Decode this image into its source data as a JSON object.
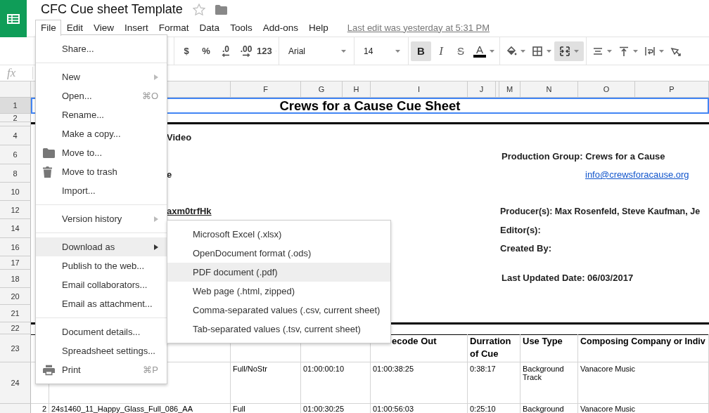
{
  "app": {
    "title": "CFC Cue sheet Template",
    "starred": false,
    "last_edit": "Last edit was yesterday at 5:31 PM"
  },
  "menus": [
    {
      "label": "File",
      "selected": true
    },
    {
      "label": "Edit",
      "selected": false
    },
    {
      "label": "View",
      "selected": false
    },
    {
      "label": "Insert",
      "selected": false
    },
    {
      "label": "Format",
      "selected": false
    },
    {
      "label": "Data",
      "selected": false
    },
    {
      "label": "Tools",
      "selected": false
    },
    {
      "label": "Add-ons",
      "selected": false
    },
    {
      "label": "Help",
      "selected": false
    }
  ],
  "toolbar": {
    "groups": [
      [
        {
          "kind": "text",
          "label": "$",
          "selected": false,
          "dropdown": false
        },
        {
          "kind": "text",
          "label": "%",
          "selected": false,
          "dropdown": false
        },
        {
          "kind": "decrease-decimals",
          "label": ".0",
          "selected": false,
          "dropdown": false
        },
        {
          "kind": "increase-decimals",
          "label": ".00",
          "selected": false,
          "dropdown": false
        },
        {
          "kind": "text",
          "label": "123",
          "selected": false,
          "dropdown": true
        }
      ],
      [
        {
          "kind": "font",
          "label": "Arial",
          "selected": false,
          "dropdown": true
        }
      ],
      [
        {
          "kind": "size",
          "label": "14",
          "selected": false,
          "dropdown": true
        }
      ],
      [
        {
          "kind": "bold",
          "label": "B",
          "selected": true,
          "dropdown": false
        },
        {
          "kind": "italic",
          "label": "I",
          "selected": false,
          "dropdown": false
        },
        {
          "kind": "strike",
          "label": "S",
          "selected": false,
          "dropdown": false
        },
        {
          "kind": "text-color",
          "label": "A",
          "selected": false,
          "dropdown": true
        }
      ],
      [
        {
          "kind": "fill",
          "selected": false,
          "dropdown": true
        },
        {
          "kind": "borders",
          "selected": false,
          "dropdown": true
        },
        {
          "kind": "merge",
          "selected": true,
          "dropdown": true
        }
      ],
      [
        {
          "kind": "halign",
          "selected": false,
          "dropdown": true
        },
        {
          "kind": "valign",
          "selected": false,
          "dropdown": true
        },
        {
          "kind": "wrap",
          "selected": false,
          "dropdown": true
        },
        {
          "kind": "rotate",
          "selected": false,
          "dropdown": false
        }
      ]
    ]
  },
  "formula_bar": {
    "label": "fx"
  },
  "sheet": {
    "column_headers": [
      "F",
      "G",
      "H",
      "I",
      "J",
      "M",
      "N",
      "O",
      "P"
    ],
    "row_headers": [
      {
        "label": "1",
        "selected": true
      },
      {
        "label": "2",
        "selected": false
      },
      {
        "selected": false
      },
      {
        "label": "4",
        "selected": false
      },
      {
        "label": "6",
        "selected": false
      },
      {
        "label": "8",
        "selected": false
      },
      {
        "label": "10",
        "selected": false
      },
      {
        "label": "12",
        "selected": false
      },
      {
        "label": "14",
        "selected": false
      },
      {
        "label": "16",
        "selected": false
      },
      {
        "label": "17",
        "selected": false
      },
      {
        "label": "18",
        "selected": false
      },
      {
        "label": "20",
        "selected": false
      },
      {
        "label": "21",
        "selected": false
      },
      {
        "label": "22",
        "selected": false
      },
      {
        "label": "23",
        "selected": false
      },
      {
        "label": "24",
        "selected": false
      },
      {
        "selected": false
      }
    ],
    "title": "Crews for a Cause Cue Sheet",
    "fragments": [
      {
        "text": "Video",
        "kind": "label"
      },
      {
        "text": "e",
        "kind": "label"
      },
      {
        "text": "axm0trfHk",
        "kind": "link"
      }
    ],
    "info": [
      {
        "text": "Production Group: Crews for a Cause",
        "kind": "label"
      },
      {
        "text": "info@crewsforacause.org",
        "kind": "link"
      },
      {
        "text": "Producer(s): Max Rosenfeld, Steve Kaufman, Je",
        "kind": "label"
      },
      {
        "text": "Editor(s):",
        "kind": "label"
      },
      {
        "text": "Created By:",
        "kind": "label"
      },
      {
        "text": "Last Updated Date: 06/03/2017",
        "kind": "label"
      }
    ],
    "table": {
      "headers": [
        "ecode Out",
        "Durration of Cue",
        "Use Type",
        "Composing Company or Indiv"
      ],
      "rows": [
        {
          "cells": [
            "Full/NoStr",
            "01:00:00:10",
            "01:00:38:25",
            "0:38:17",
            "Background Track",
            "Vanacore Music"
          ]
        },
        {
          "number": "2",
          "title": "24s1460_11_Happy_Glass_Full_086_AA",
          "cells": [
            "Full",
            "01:00:30:25",
            "01:00:56:03",
            "0:25:10",
            "Background",
            "Vanacore Music"
          ]
        }
      ]
    }
  },
  "file_menu": {
    "items": [
      {
        "kind": "item",
        "label": "Share...",
        "selected": false
      },
      {
        "kind": "separator"
      },
      {
        "kind": "item",
        "label": "New",
        "submenu": true,
        "selected": false
      },
      {
        "kind": "item",
        "label": "Open...",
        "shortcut": "⌘O",
        "selected": false
      },
      {
        "kind": "item",
        "label": "Rename...",
        "selected": false
      },
      {
        "kind": "item",
        "label": "Make a copy...",
        "selected": false
      },
      {
        "kind": "folder",
        "label": "Move to...",
        "selected": false
      },
      {
        "kind": "trash",
        "label": "Move to trash",
        "selected": false
      },
      {
        "kind": "item",
        "label": "Import...",
        "selected": false
      },
      {
        "kind": "separator"
      },
      {
        "kind": "item",
        "label": "Version history",
        "submenu": true,
        "selected": false
      },
      {
        "kind": "separator"
      },
      {
        "kind": "item",
        "label": "Download as",
        "submenu": true,
        "selected": true
      },
      {
        "kind": "item",
        "label": "Publish to the web...",
        "selected": false
      },
      {
        "kind": "item",
        "label": "Email collaborators...",
        "selected": false
      },
      {
        "kind": "item",
        "label": "Email as attachment...",
        "selected": false
      },
      {
        "kind": "separator"
      },
      {
        "kind": "item",
        "label": "Document details...",
        "selected": false
      },
      {
        "kind": "item",
        "label": "Spreadsheet settings...",
        "selected": false
      },
      {
        "kind": "print",
        "label": "Print",
        "shortcut": "⌘P",
        "selected": false
      }
    ]
  },
  "download_submenu": {
    "items": [
      {
        "label": "Microsoft Excel (.xlsx)",
        "selected": false
      },
      {
        "label": "OpenDocument format (.ods)",
        "selected": false
      },
      {
        "label": "PDF document (.pdf)",
        "selected": true
      },
      {
        "label": "Web page (.html, zipped)",
        "selected": false
      },
      {
        "label": "Comma-separated values (.csv, current sheet)",
        "selected": false
      },
      {
        "label": "Tab-separated values (.tsv, current sheet)",
        "selected": false
      }
    ]
  }
}
